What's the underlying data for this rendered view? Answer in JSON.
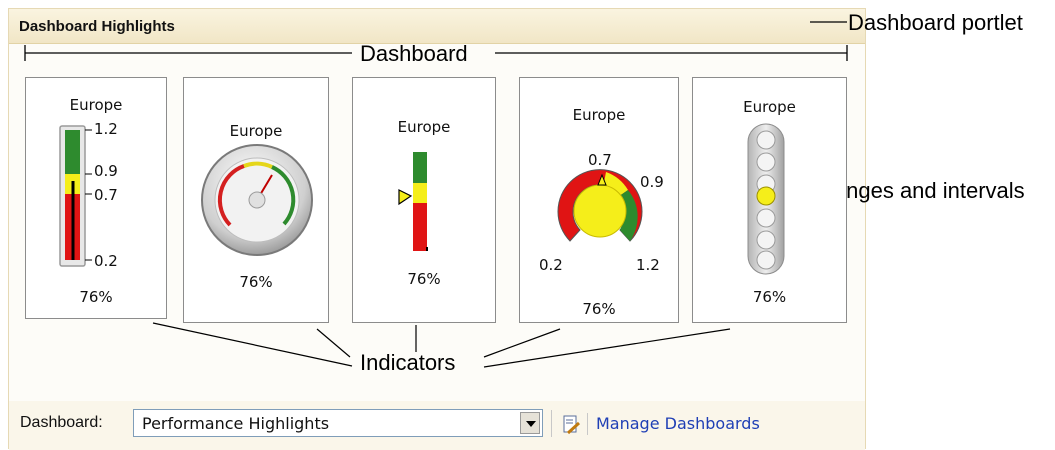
{
  "portlet": {
    "title": "Dashboard Highlights"
  },
  "callouts": {
    "portlet": "Dashboard portlet",
    "dashboard": "Dashboard",
    "indicators": "Indicators",
    "ranges": "Ranges and intervals"
  },
  "indicators": [
    {
      "region": "Europe",
      "value": "76%",
      "ticks": [
        "1.2",
        "0.9",
        "0.7",
        "0.2"
      ],
      "level": 0.76
    },
    {
      "region": "Europe",
      "value": "76%",
      "level": 0.76
    },
    {
      "region": "Europe",
      "value": "76%",
      "level": 0.76
    },
    {
      "region": "Europe",
      "value": "76%",
      "ticks": [
        "0.7",
        "0.9",
        "0.2",
        "1.2"
      ],
      "level": 0.76
    },
    {
      "region": "Europe",
      "value": "76%",
      "active_light": 3
    }
  ],
  "footer": {
    "dashboard_label": "Dashboard:",
    "selected_dashboard": "Performance Highlights",
    "manage_link": "Manage Dashboards"
  },
  "colors": {
    "title": "#c18a25",
    "green": "#2e8b2e",
    "yellow": "#f5ee1a",
    "red": "#e01414",
    "link": "#1f3fb5"
  }
}
